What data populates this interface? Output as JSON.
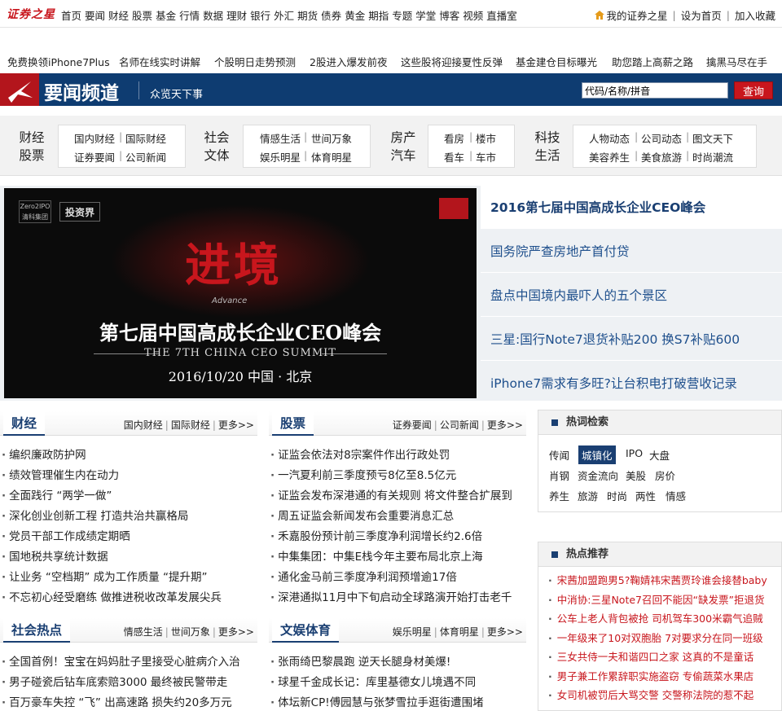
{
  "logo": "证券之星",
  "top_nav": [
    "首页",
    "要闻",
    "财经",
    "股票",
    "基金",
    "行情",
    "数据",
    "理财",
    "银行",
    "外汇",
    "期货",
    "债券",
    "黄金",
    "期指",
    "专题",
    "学堂",
    "博客",
    "视频",
    "直播室"
  ],
  "top_links": {
    "my_star": "我的证券之星",
    "set_home": "设为首页",
    "favorite": "加入收藏"
  },
  "promo": [
    "免费换领iPhone7Plus",
    "名师在线实时讲解",
    "个股明日走势预测",
    "2股进入爆发前夜",
    "这些股将迎接夏性反弹",
    "基金建仓目标曝光",
    "助您踏上高薪之路",
    "擒黑马尽在手"
  ],
  "banner": {
    "title": "要闻频道",
    "subtitle": "众览天下事",
    "search_placeholder": "代码/名称/拼音",
    "search_button": "查询"
  },
  "categories": [
    {
      "head": [
        "财经",
        "股票"
      ],
      "links": [
        [
          "国内财经",
          "国际财经"
        ],
        [
          "证券要闻",
          "公司新闻"
        ]
      ]
    },
    {
      "head": [
        "社会",
        "文体"
      ],
      "links": [
        [
          "情感生活",
          "世间万象"
        ],
        [
          "娱乐明星",
          "体育明星"
        ]
      ]
    },
    {
      "head": [
        "房产",
        "汽车"
      ],
      "links": [
        [
          "看房",
          "楼市"
        ],
        [
          "看车",
          "车市"
        ]
      ]
    },
    {
      "head": [
        "科技",
        "生活"
      ],
      "links": [
        [
          "人物动态",
          "公司动态",
          "图文天下"
        ],
        [
          "美容养生",
          "美食旅游",
          "时尚潮流"
        ]
      ]
    }
  ],
  "hero": {
    "badge_left": "Zero2IPO 清科集团",
    "badge_tag": "投资界",
    "big": "进境",
    "advance": "Advance",
    "summit": "第七届中国高成长企业CEO峰会",
    "en": "THE 7TH CHINA CEO SUMMIT",
    "date": "2016/10/20 中国 · 北京"
  },
  "headlines": [
    "2016第七届中国高成长企业CEO峰会",
    "国务院严查房地产首付贷",
    "盘点中国境内最吓人的五个景区",
    "三星:国行Note7退货补贴200 换S7补贴600",
    "iPhone7需求有多旺?让台积电打破营收记录"
  ],
  "sections": {
    "finance": {
      "title": "财经",
      "links": [
        "国内财经",
        "国际财经",
        "更多>>"
      ],
      "items": [
        "编织廉政防护网",
        "绩效管理催生内在动力",
        "全面践行 “两学一做”",
        "深化创业创新工程 打造共治共赢格局",
        "党员干部工作成绩定期晒",
        "国地税共享统计数据",
        "让业务 “空档期” 成为工作质量 “提升期”",
        "不忘初心经受磨练 做推进税收改革发展尖兵"
      ]
    },
    "stocks": {
      "title": "股票",
      "links": [
        "证券要闻",
        "公司新闻",
        "更多>>"
      ],
      "items": [
        "证监会依法对8宗案件作出行政处罚",
        "一汽夏利前三季度预亏8亿至8.5亿元",
        "证监会发布深港通的有关规则 将文件整合扩展到",
        "周五证监会新闻发布会重要消息汇总",
        "禾嘉股份预计前三季度净利润增长约2.6倍",
        "中集集团：中集E栈今年主要布局北京上海",
        "通化金马前三季度净利润预增逾17倍",
        "深港通拟11月中下旬启动全球路演开始打击老千"
      ]
    },
    "society": {
      "title": "社会热点",
      "links": [
        "情感生活",
        "世间万象",
        "更多>>"
      ],
      "items": [
        "全国首例！宝宝在妈妈肚子里接受心脏病介入治",
        "男子碰瓷后钻车底索赔3000 最终被民警带走",
        "百万豪车失控 “飞” 出高速路 损失约20多万元"
      ]
    },
    "ent": {
      "title": "文娱体育",
      "links": [
        "娱乐明星",
        "体育明星",
        "更多>>"
      ],
      "items": [
        "张雨绮巴黎晨跑 逆天长腿身材美爆!",
        "球星千金成长记：库里基德女儿境遇不同",
        "体坛新CP!傅园慧与张梦雪拉手逛街遭围堵"
      ]
    }
  },
  "hot_search": {
    "title": "热词检索",
    "rows": [
      [
        "传闻",
        "城镇化",
        "IPO",
        "大盘"
      ],
      [
        "肖钢",
        "资金流向",
        "美股",
        "房价"
      ],
      [
        "养生",
        "旅游",
        "时尚",
        "两性",
        "情感"
      ]
    ],
    "active": "城镇化"
  },
  "hot_rec": {
    "title": "热点推荐",
    "items": [
      "宋茜加盟跑男5?鞠婧祎宋茜贾玲谁会接替baby",
      "中消协:三星Note7召回不能因“缺发票”拒退货",
      "公车上老人背包被抢 司机驾车300米霸气追贼",
      "一年级来了10对双胞胎 7对要求分在同一班级",
      "三女共侍一夫和谐四口之家 这真的不是童话",
      "男子兼工作累辞职实施盗窃 专偷蔬菜水果店",
      "女司机被罚后大骂交警 交警称法院的惹不起"
    ]
  },
  "colors": {
    "brand_red": "#c8161d",
    "navy": "#0e3c71",
    "link_blue": "#1e4f8c"
  }
}
